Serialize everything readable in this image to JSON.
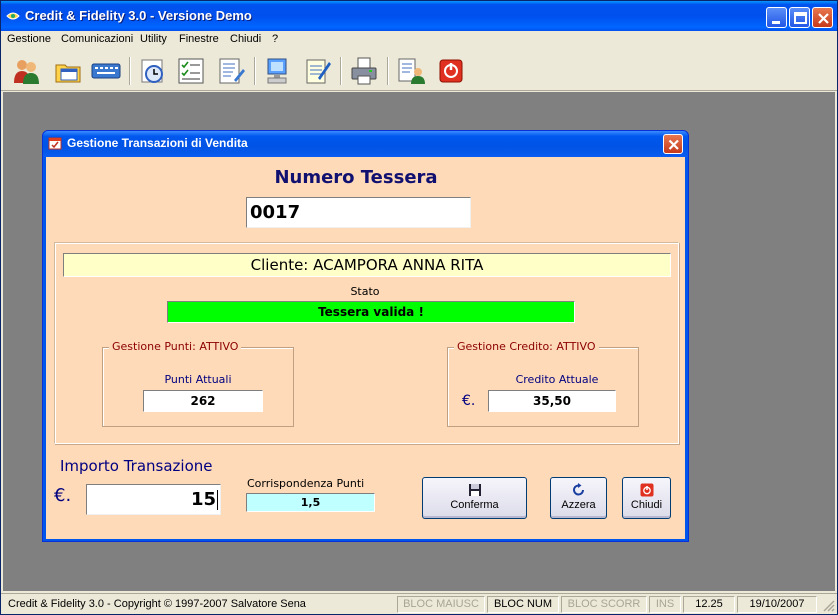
{
  "window": {
    "title": "Credit & Fidelity 3.0 - Versione Demo"
  },
  "menu": [
    "Gestione",
    "Comunicazioni",
    "Utility",
    "Finestre",
    "Chiudi",
    "?"
  ],
  "toolbar": {
    "icons": [
      "users-icon",
      "calendar-folder-icon",
      "keyboard-icon",
      "clock-icon",
      "checklist-icon",
      "edit-document-icon",
      "computer-icon",
      "notepad-icon",
      "printer-icon",
      "user-info-icon",
      "power-icon"
    ]
  },
  "dialog": {
    "title": "Gestione Transazioni di Vendita",
    "tessera_label": "Numero Tessera",
    "tessera_value": "0017",
    "cliente": "Cliente: ACAMPORA ANNA RITA",
    "stato_label": "Stato",
    "stato_value": "Tessera valida !",
    "punti": {
      "title": "Gestione Punti: ATTIVO",
      "label": "Punti Attuali",
      "value": "262"
    },
    "credito": {
      "title": "Gestione Credito: ATTIVO",
      "label": "Credito Attuale",
      "currency": "€.",
      "value": "35,50"
    },
    "importo_label": "Importo Transazione",
    "importo_currency": "€.",
    "importo_value": "15",
    "corrispondenza_label": "Corrispondenza Punti",
    "corrispondenza_value": "1,5",
    "buttons": {
      "conferma": "Conferma",
      "azzera": "Azzera",
      "chiudi": "Chiudi"
    }
  },
  "statusbar": {
    "copyright": "Credit & Fidelity 3.0 - Copyright © 1997-2007 Salvatore Sena",
    "caps": "BLOC MAIUSC",
    "num": "BLOC NUM",
    "scroll": "BLOC SCORR",
    "ins": "INS",
    "time": "12.25",
    "date": "19/10/2007"
  },
  "colors": {
    "dialog_bg": "#ffdab9",
    "status_ok": "#00ff00",
    "cliente_bg": "#ffffc8",
    "corrispondenza_bg": "#c0ffff",
    "label_blue": "#000080",
    "group_title_red": "#8b0000"
  }
}
